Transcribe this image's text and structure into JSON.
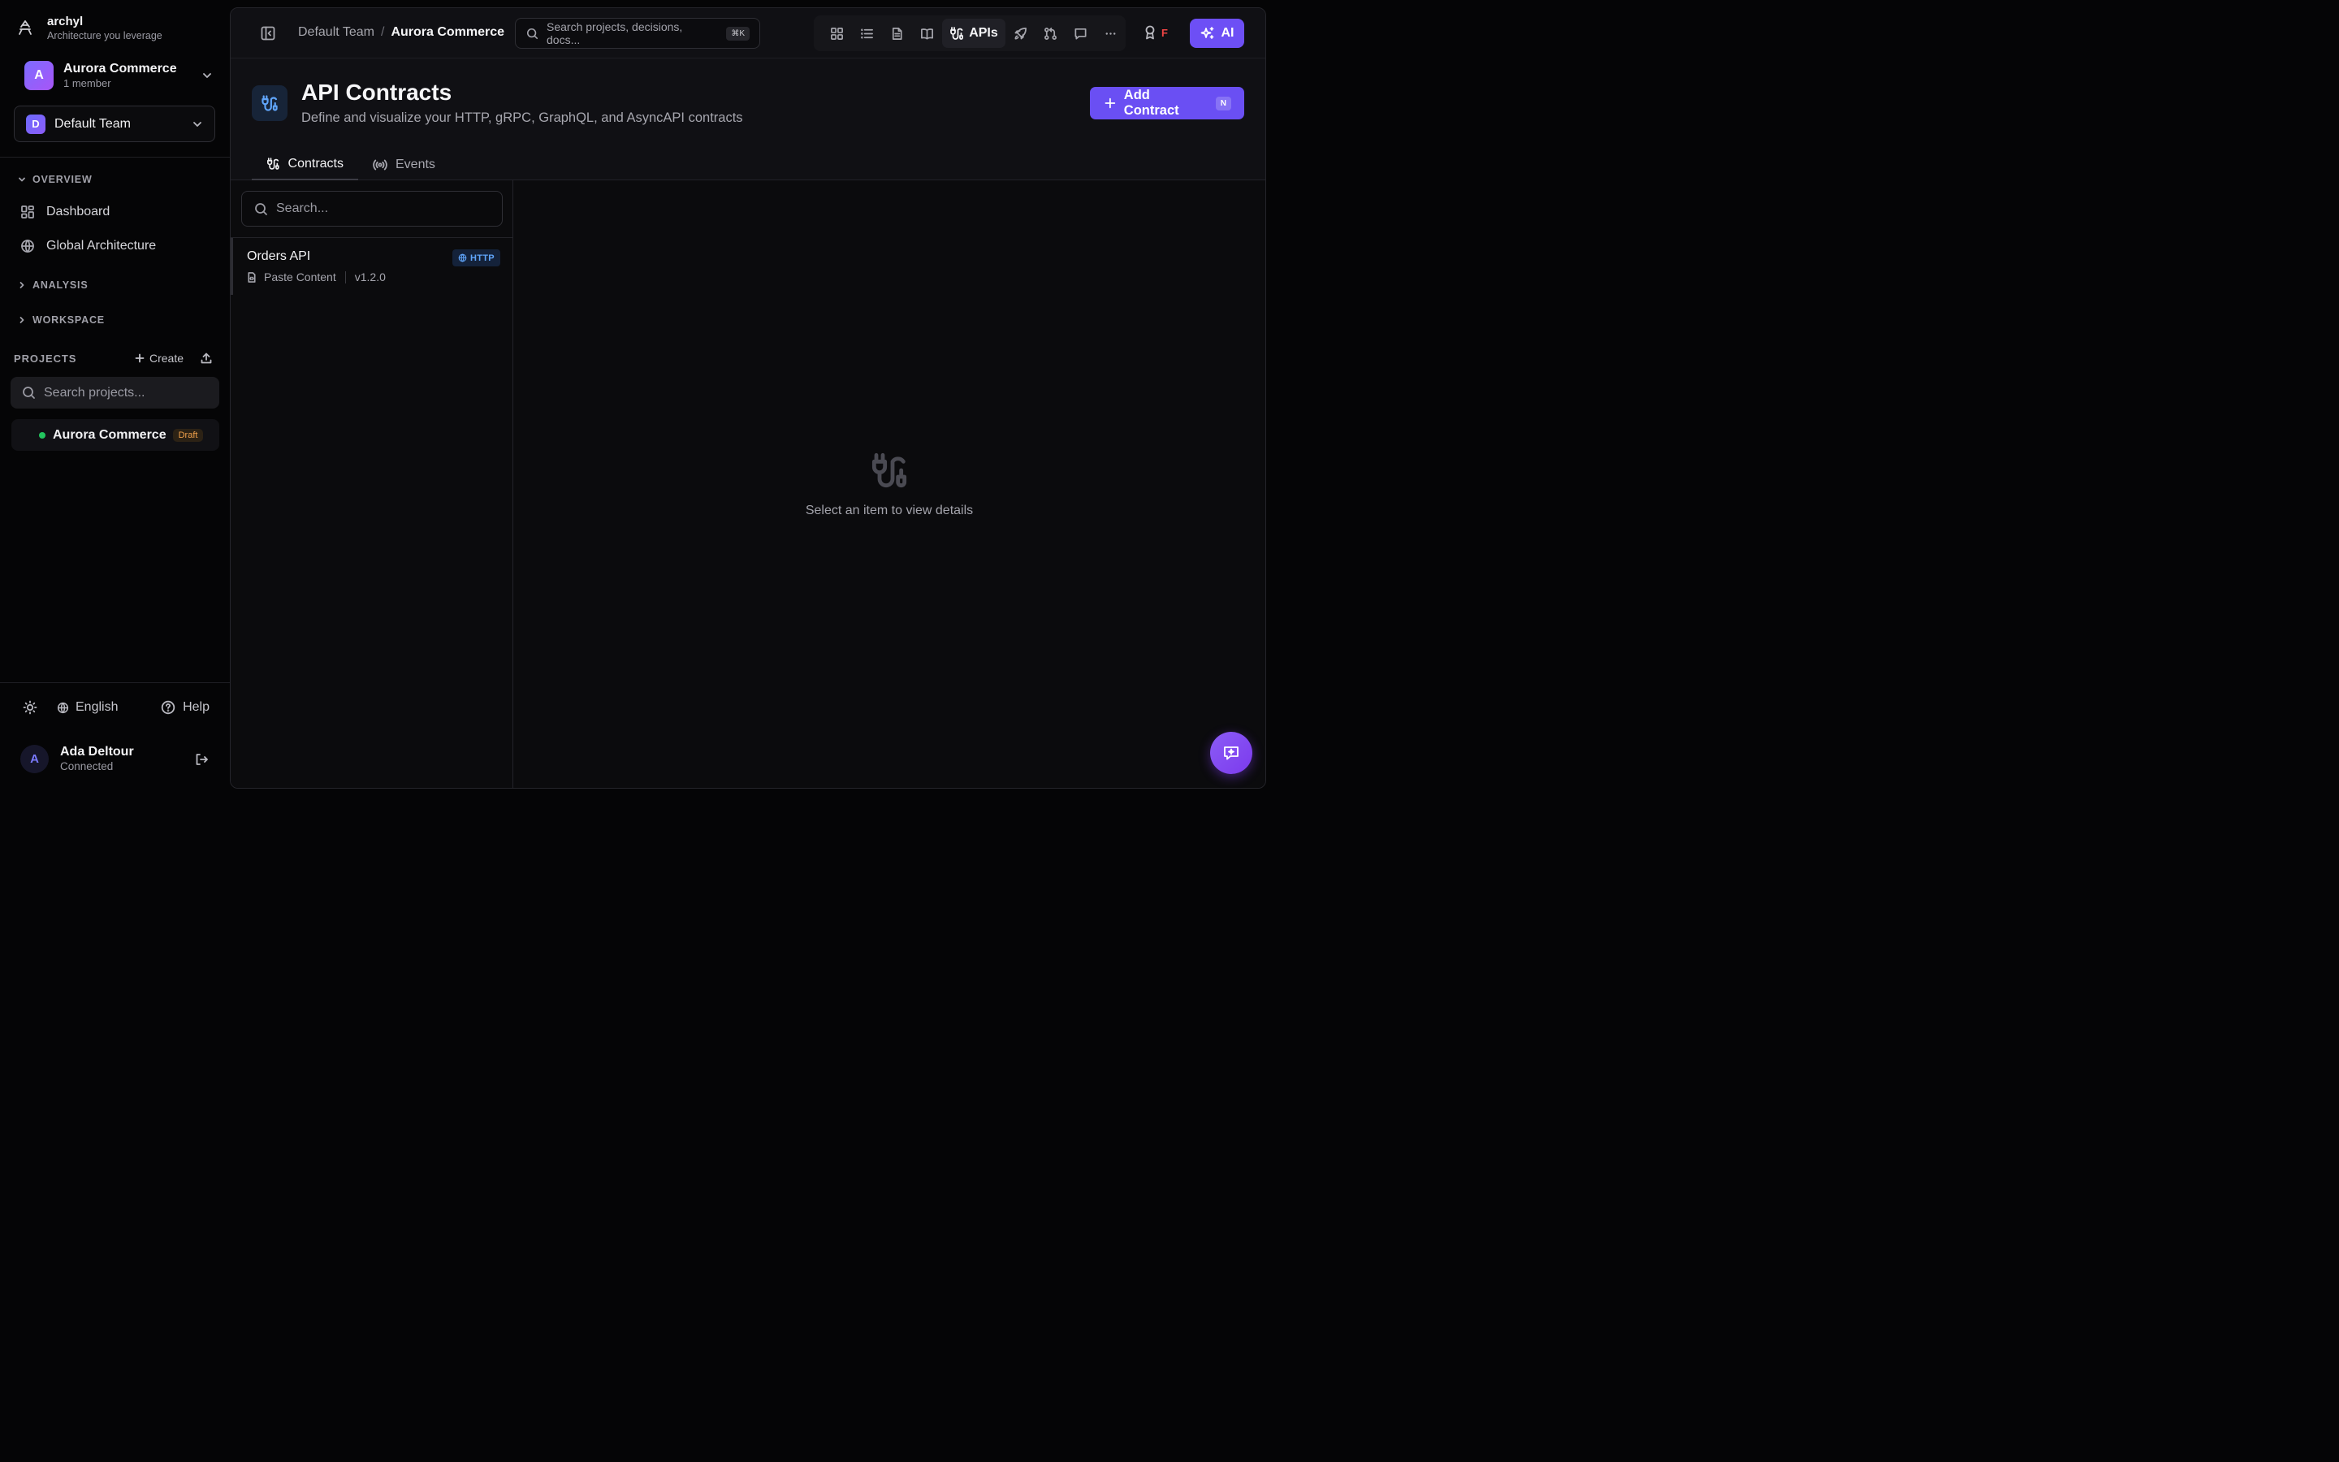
{
  "brand": {
    "name": "archyl",
    "tagline": "Architecture you leverage"
  },
  "org": {
    "initial": "A",
    "name": "Aurora Commerce",
    "members": "1 member"
  },
  "team": {
    "initial": "D",
    "name": "Default Team"
  },
  "sidebar": {
    "overview_label": "OVERVIEW",
    "items": [
      {
        "label": "Dashboard",
        "icon": "dashboard-icon"
      },
      {
        "label": "Global Architecture",
        "icon": "globe-icon"
      }
    ],
    "analysis_label": "ANALYSIS",
    "workspace_label": "WORKSPACE",
    "projects_label": "PROJECTS",
    "create_label": "Create",
    "project_search_placeholder": "Search projects...",
    "projects": [
      {
        "name": "Aurora Commerce",
        "status": "Draft",
        "status_color": "#22c55e"
      }
    ]
  },
  "footer": {
    "language": "English",
    "help": "Help"
  },
  "user": {
    "initial": "A",
    "name": "Ada Deltour",
    "status": "Connected"
  },
  "topbar": {
    "breadcrumb": [
      "Default Team",
      "Aurora Commerce"
    ],
    "breadcrumb_sep": "/",
    "search_placeholder": "Search projects, decisions, docs...",
    "search_shortcut": "⌘K",
    "active_tool": "APIs",
    "notify_flag": "F",
    "ai_label": "AI"
  },
  "page": {
    "title": "API Contracts",
    "subtitle": "Define and visualize your HTTP, gRPC, GraphQL, and AsyncAPI contracts",
    "add_button": "Add Contract",
    "add_shortcut": "N",
    "tabs": [
      "Contracts",
      "Events"
    ]
  },
  "list": {
    "search_placeholder": "Search...",
    "items": [
      {
        "title": "Orders API",
        "protocol": "HTTP",
        "source": "Paste Content",
        "version": "v1.2.0"
      }
    ]
  },
  "detail": {
    "empty_text": "Select an item to view details"
  },
  "colors": {
    "accent": "#6a4ff3",
    "http_badge": "#60a5fa",
    "draft_badge": "#f0a04b"
  }
}
